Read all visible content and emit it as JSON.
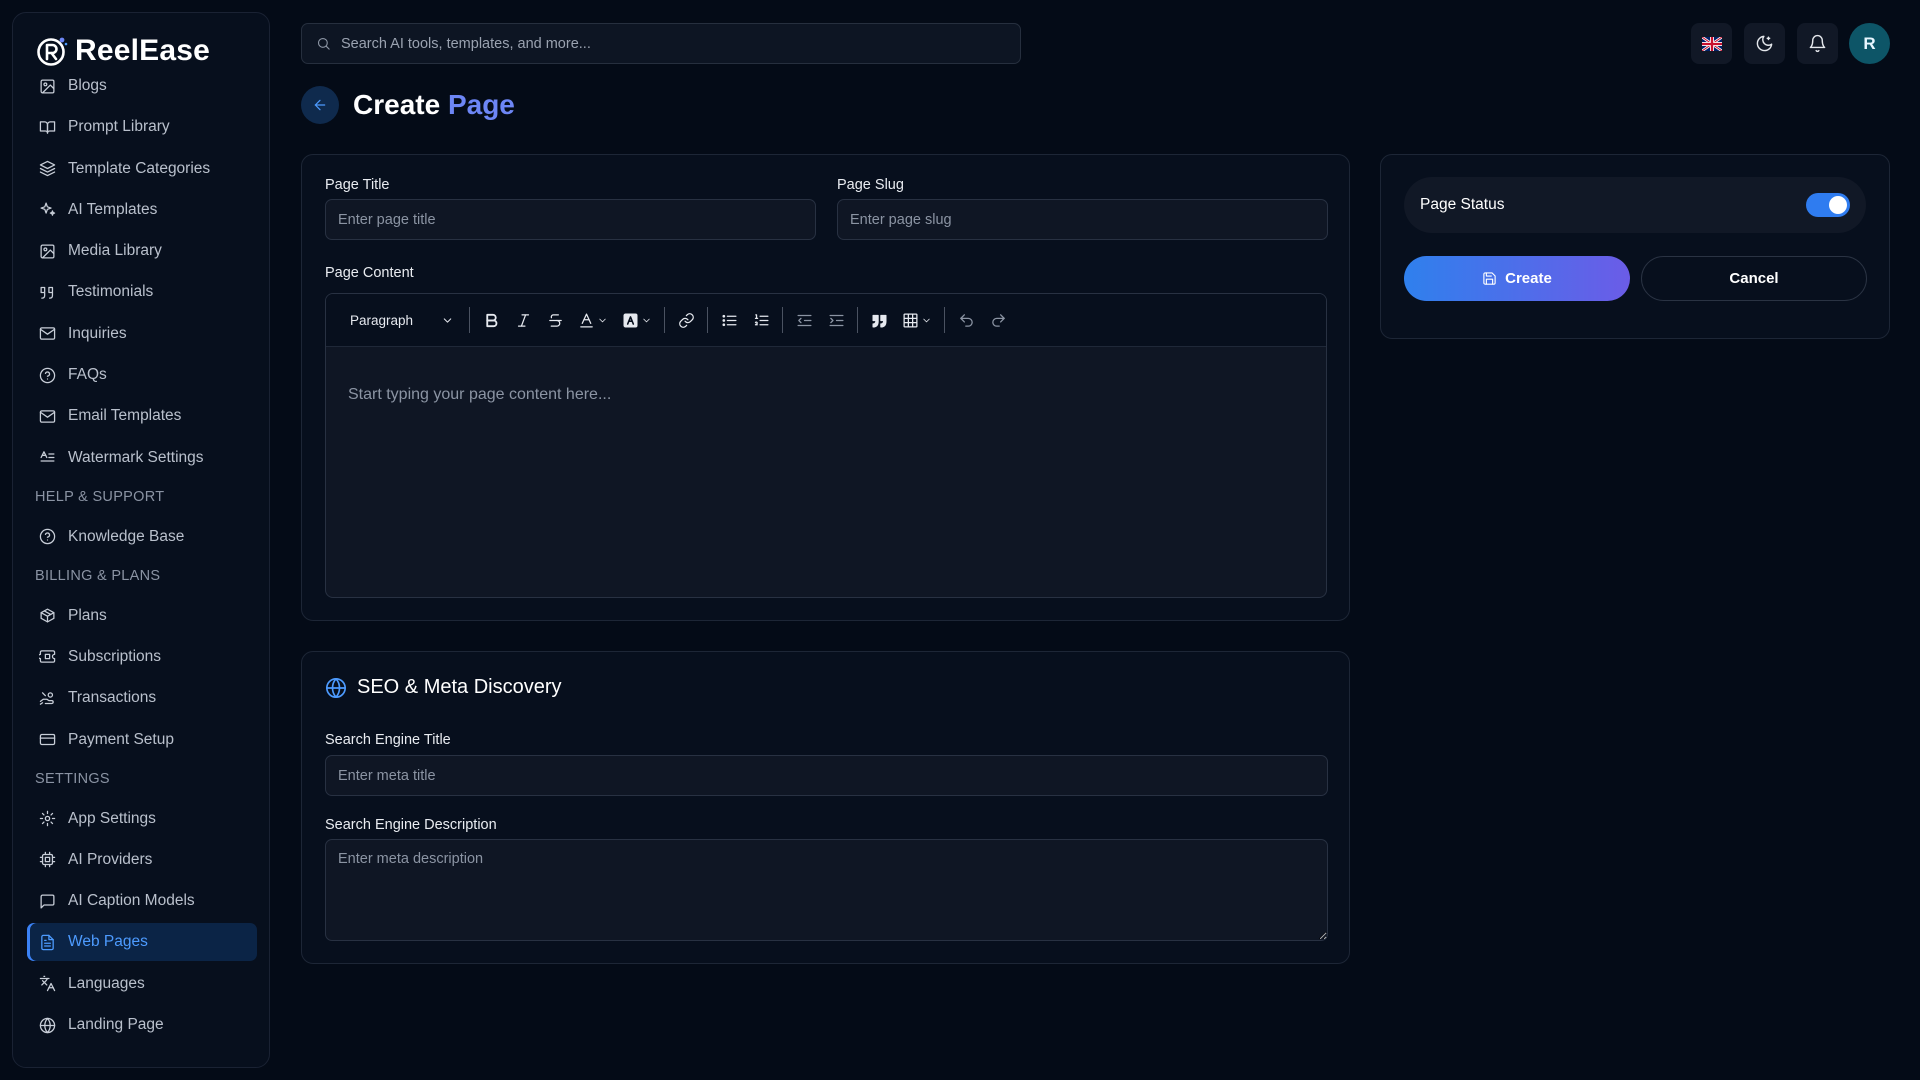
{
  "app": {
    "name": "ReelEase"
  },
  "sidebar": {
    "items_top": [
      {
        "label": "Blogs",
        "icon": "image-edit-icon"
      },
      {
        "label": "Prompt Library",
        "icon": "book-open-icon"
      },
      {
        "label": "Template Categories",
        "icon": "layers-icon"
      },
      {
        "label": "AI Templates",
        "icon": "sparkles-icon"
      },
      {
        "label": "Media Library",
        "icon": "image-icon"
      },
      {
        "label": "Testimonials",
        "icon": "quote-icon"
      },
      {
        "label": "Inquiries",
        "icon": "mail-icon"
      },
      {
        "label": "FAQs",
        "icon": "help-circle-icon"
      },
      {
        "label": "Email Templates",
        "icon": "mail-icon"
      },
      {
        "label": "Watermark Settings",
        "icon": "text-align-icon"
      }
    ],
    "section_help": "HELP & SUPPORT",
    "items_help": [
      {
        "label": "Knowledge Base",
        "icon": "help-circle-icon"
      }
    ],
    "section_billing": "BILLING & PLANS",
    "items_billing": [
      {
        "label": "Plans",
        "icon": "package-icon"
      },
      {
        "label": "Subscriptions",
        "icon": "ticket-icon"
      },
      {
        "label": "Transactions",
        "icon": "hand-coins-icon"
      },
      {
        "label": "Payment Setup",
        "icon": "credit-card-icon"
      }
    ],
    "section_settings": "SETTINGS",
    "items_settings": [
      {
        "label": "App Settings",
        "icon": "gear-icon"
      },
      {
        "label": "AI Providers",
        "icon": "cpu-icon"
      },
      {
        "label": "AI Caption Models",
        "icon": "message-square-icon"
      },
      {
        "label": "Web Pages",
        "icon": "file-text-icon",
        "active": true
      },
      {
        "label": "Languages",
        "icon": "languages-icon"
      },
      {
        "label": "Landing Page",
        "icon": "globe-icon"
      }
    ]
  },
  "topbar": {
    "search_placeholder": "Search AI tools, templates, and more...",
    "avatar_initial": "R"
  },
  "header": {
    "title_main": "Create",
    "title_accent": "Page"
  },
  "form": {
    "page_title_label": "Page Title",
    "page_title_placeholder": "Enter page title",
    "page_slug_label": "Page Slug",
    "page_slug_placeholder": "Enter page slug",
    "page_content_label": "Page Content",
    "editor_block_type": "Paragraph",
    "editor_placeholder": "Start typing your page content here..."
  },
  "seo": {
    "heading": "SEO & Meta Discovery",
    "title_label": "Search Engine Title",
    "title_placeholder": "Enter meta title",
    "description_label": "Search Engine Description",
    "description_placeholder": "Enter meta description"
  },
  "side_panel": {
    "status_label": "Page Status",
    "status_enabled": true,
    "create_label": "Create",
    "cancel_label": "Cancel"
  },
  "colors": {
    "accent": "#3b82f6",
    "background": "#040b17",
    "gradient_end": "#6b5ce7"
  }
}
